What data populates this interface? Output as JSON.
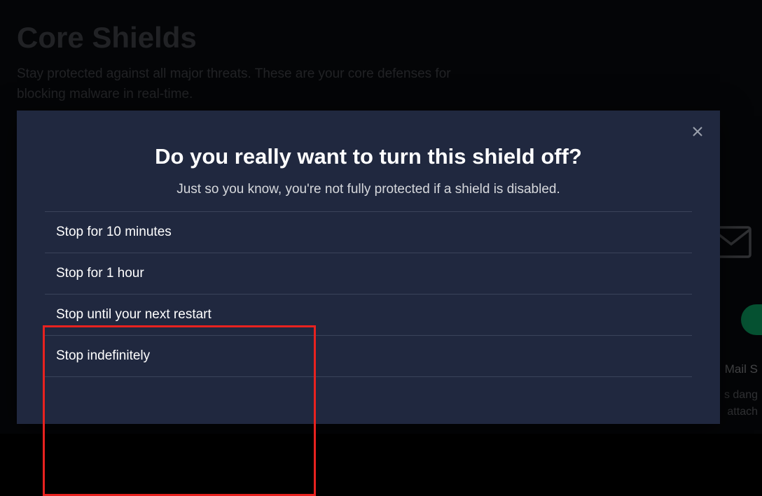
{
  "page": {
    "title": "Core Shields",
    "subtitle": "Stay protected against all major threats. These are your core defenses for blocking malware in real-time."
  },
  "bg": {
    "label1": "Mail S",
    "label2": "s dang",
    "label3": "attach"
  },
  "modal": {
    "title": "Do you really want to turn this shield off?",
    "subtitle": "Just so you know, you're not fully protected if a shield is disabled.",
    "options": [
      "Stop for 10 minutes",
      "Stop for 1 hour",
      "Stop until your next restart",
      "Stop indefinitely"
    ]
  }
}
